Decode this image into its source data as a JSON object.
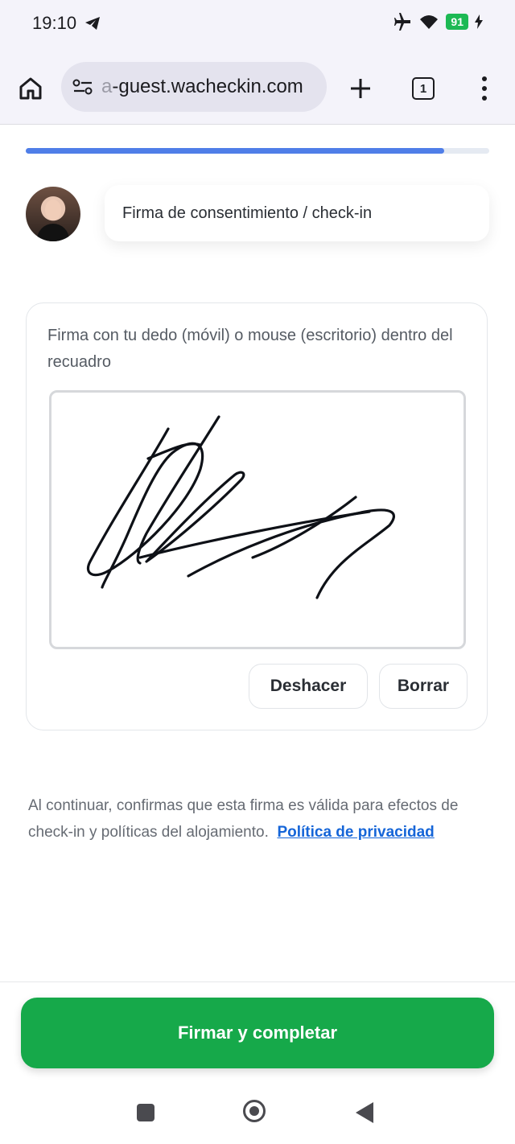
{
  "status_bar": {
    "time": "19:10",
    "battery": "91",
    "icons": [
      "telegram-icon",
      "airplane-icon",
      "wifi-icon",
      "battery-icon",
      "charging-icon"
    ]
  },
  "browser": {
    "url_faded": "a",
    "url_rest": "-guest.wacheckin.com",
    "tab_count": "1",
    "icons": [
      "home-icon",
      "site-settings-icon",
      "new-tab-icon",
      "tabs-icon",
      "menu-icon"
    ]
  },
  "progress": {
    "fraction": 0.903,
    "fill_color": "#4f7ee8",
    "track_color": "#e5eaf2"
  },
  "header": {
    "title": "Firma de consentimiento / check-in"
  },
  "signature": {
    "instruction": "Firma con tu dedo (móvil) o mouse (escritorio) dentro del recuadro",
    "undo_label": "Deshacer",
    "clear_label": "Borrar"
  },
  "disclaimer": {
    "text": "Al continuar, confirmas que esta firma es válida para efectos de check-in y políticas del alojamiento.",
    "link": "Política de privacidad"
  },
  "actions": {
    "submit_label": "Firmar y completar",
    "submit_color": "#16a94a"
  },
  "system_nav": {
    "icons": [
      "recent-apps-icon",
      "home-button-icon",
      "back-icon"
    ]
  }
}
